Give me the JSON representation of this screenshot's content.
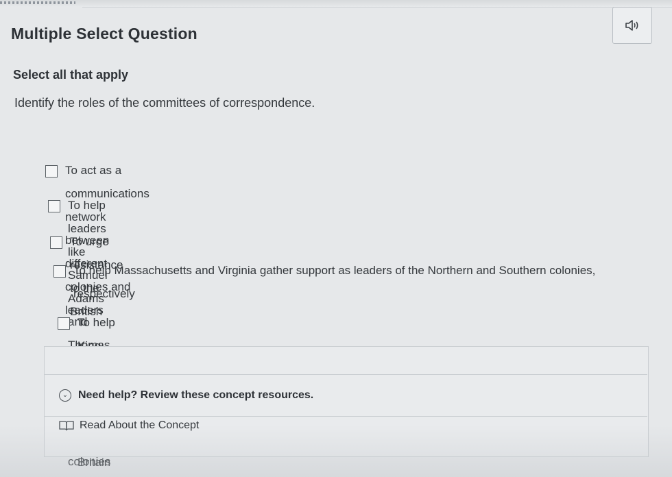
{
  "header": {
    "title": "Multiple Select Question",
    "audio_icon": "speaker-icon"
  },
  "question": {
    "instruction": "Select all that apply",
    "prompt": "Identify the roles of the committees of correspondence."
  },
  "options": [
    {
      "label": "To act as a communications network between different colonies and leaders",
      "checked": false
    },
    {
      "label": "To help leaders like Samuel Adams and Thomas Jefferson vie for control of the colonies",
      "checked": false
    },
    {
      "label": "To urge resistance to the British",
      "checked": false
    },
    {
      "label": "To help Massachusetts and Virginia gather support as leaders of the Northern and Southern colonies, respectively",
      "checked": false
    },
    {
      "label": "To help King George's spies pass information back to Britain",
      "checked": false
    }
  ],
  "help": {
    "toggle_label": "Need help? Review these concept resources.",
    "toggle_icon": "chevron-down-icon",
    "resource_label": "Read About the Concept",
    "resource_icon": "book-icon"
  }
}
